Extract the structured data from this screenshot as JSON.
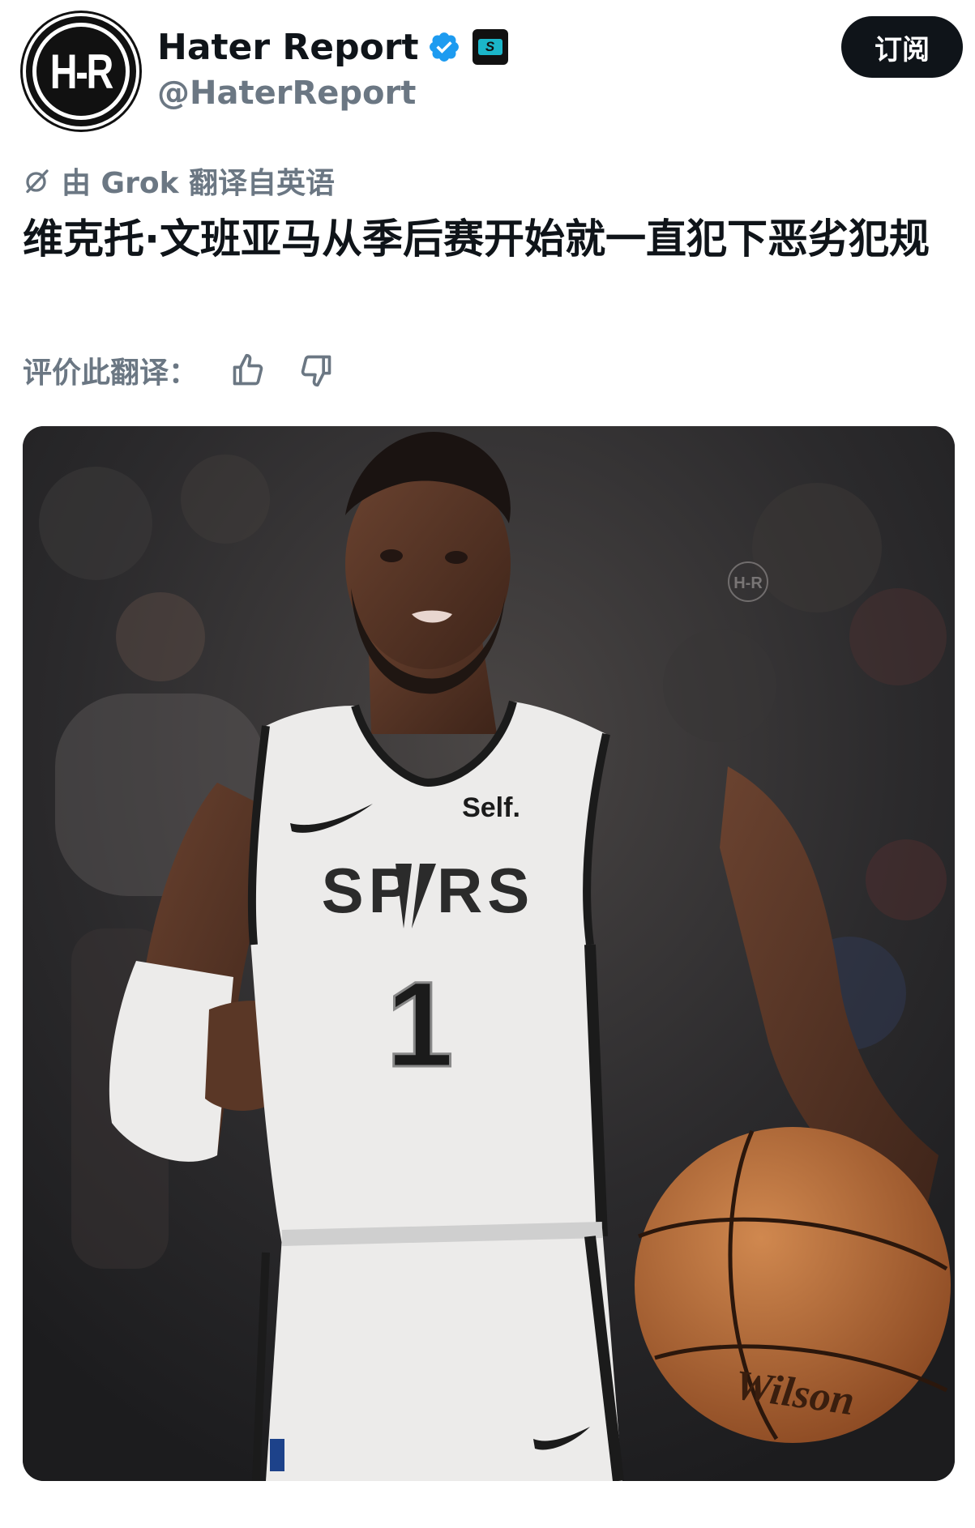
{
  "author": {
    "avatar_text": "H-R",
    "display_name": "Hater Report",
    "handle": "@HaterReport",
    "verified_icon": "verified-badge-icon",
    "brand_badge": "S"
  },
  "actions": {
    "subscribe_label": "订阅"
  },
  "translation": {
    "note": "由 Grok 翻译自英语",
    "rate_label": "评价此翻译：",
    "thumbs_up_icon": "thumbs-up-icon",
    "thumbs_down_icon": "thumbs-down-icon"
  },
  "tweet": {
    "text": "维克托·文班亚马从季后赛开始就一直犯下恶劣犯规"
  },
  "media": {
    "jersey_sponsor": "Self.",
    "jersey_team": "SP  RS",
    "jersey_number": "1",
    "watermark": "H-R",
    "ball_brand": "Wilson"
  },
  "colors": {
    "accent_blue": "#1d9bf0",
    "secondary_text": "#6b7783",
    "primary_text": "#0f1419"
  }
}
